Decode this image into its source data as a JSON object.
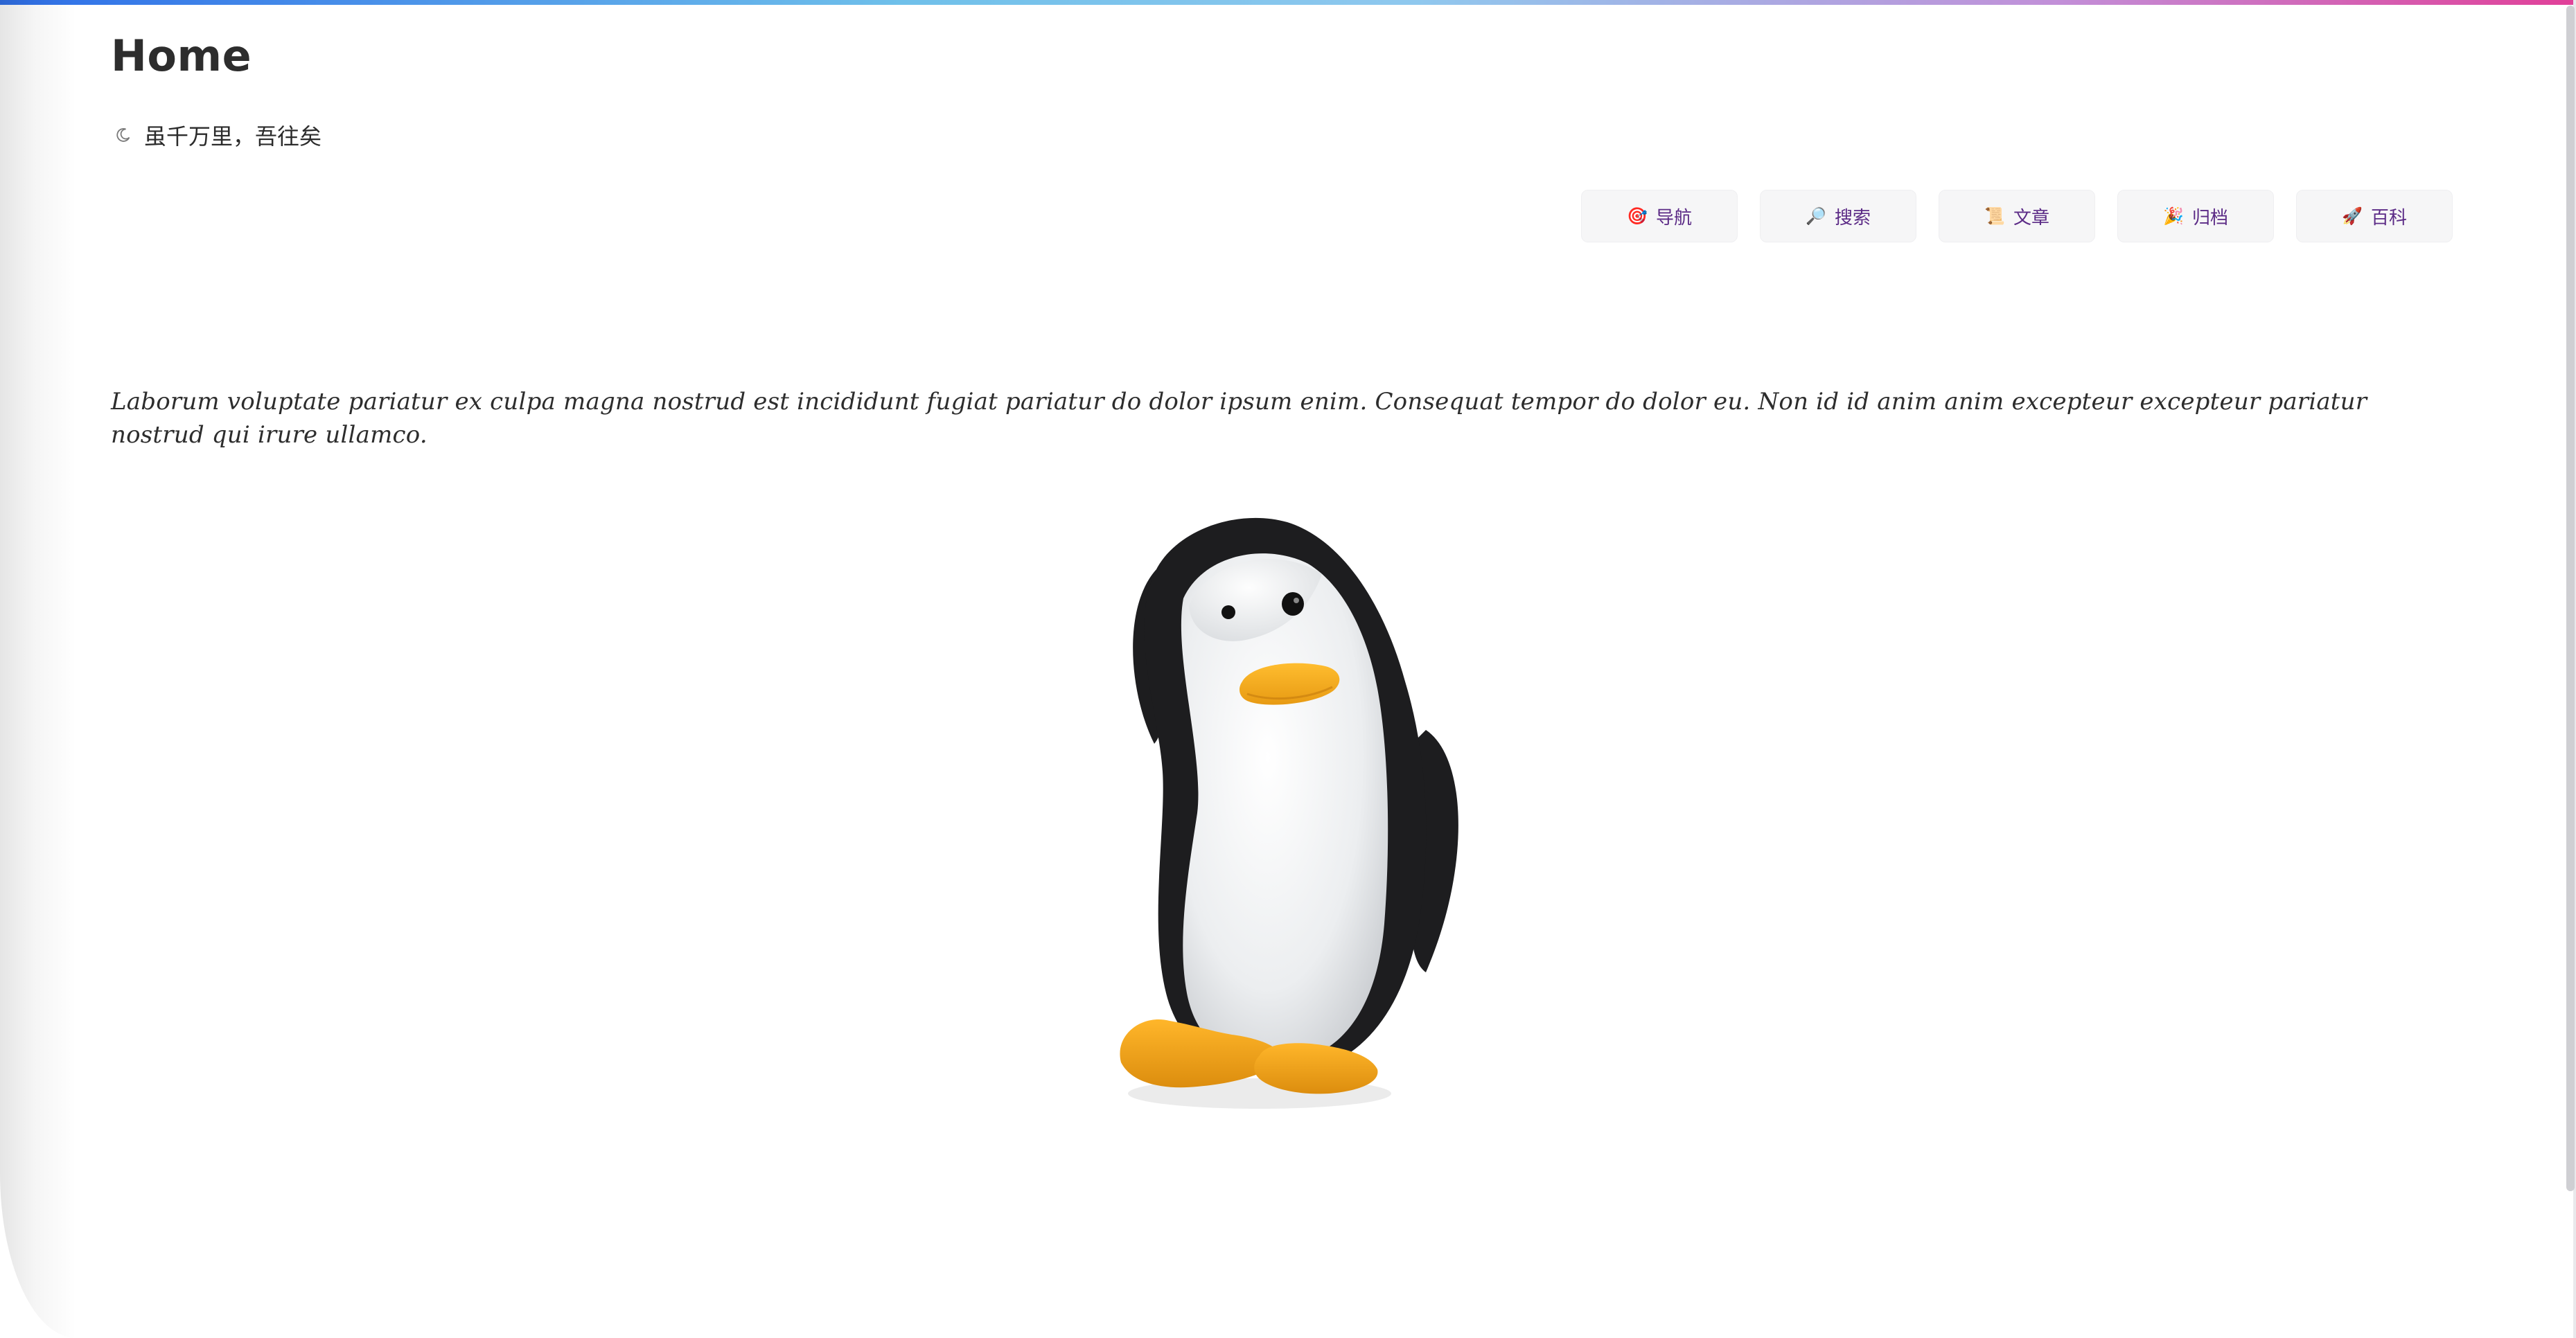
{
  "header": {
    "title": "Home",
    "motto": "虽千万里，吾往矣"
  },
  "nav": {
    "items": [
      {
        "emoji": "🎯",
        "label": "导航"
      },
      {
        "emoji": "🔎",
        "label": "搜索"
      },
      {
        "emoji": "📜",
        "label": "文章"
      },
      {
        "emoji": "🎉",
        "label": "归档"
      },
      {
        "emoji": "🚀",
        "label": "百科"
      }
    ]
  },
  "content": {
    "paragraph": "Laborum voluptate pariatur ex culpa magna nostrud est incididunt fugiat pariatur do dolor ipsum enim. Consequat tempor do dolor eu. Non id id anim anim excepteur excepteur pariatur nostrud qui irure ullamco."
  },
  "colors": {
    "gradient_start": "#2f6fe8",
    "gradient_end": "#e13f98",
    "nav_text": "#5b2a86",
    "nav_bg": "#f6f6f7"
  }
}
